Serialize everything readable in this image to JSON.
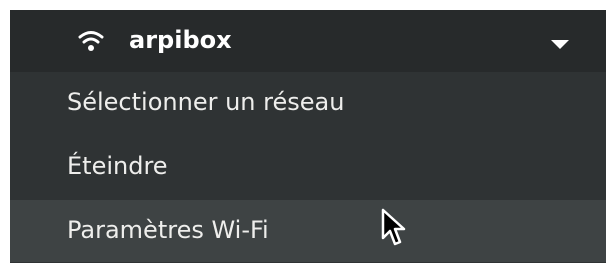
{
  "network_section": {
    "icon": "wifi-icon",
    "name": "arpibox",
    "expand_icon": "chevron-down-icon"
  },
  "menu_items": [
    {
      "label": "Sélectionner un réseau"
    },
    {
      "label": "Éteindre"
    },
    {
      "label": "Paramètres Wi-Fi",
      "hovered": true
    }
  ],
  "colors": {
    "menu_background": "#2f3334",
    "header_background": "#272a2b",
    "hover_background": "#3e4344",
    "text": "#eeeeec"
  }
}
